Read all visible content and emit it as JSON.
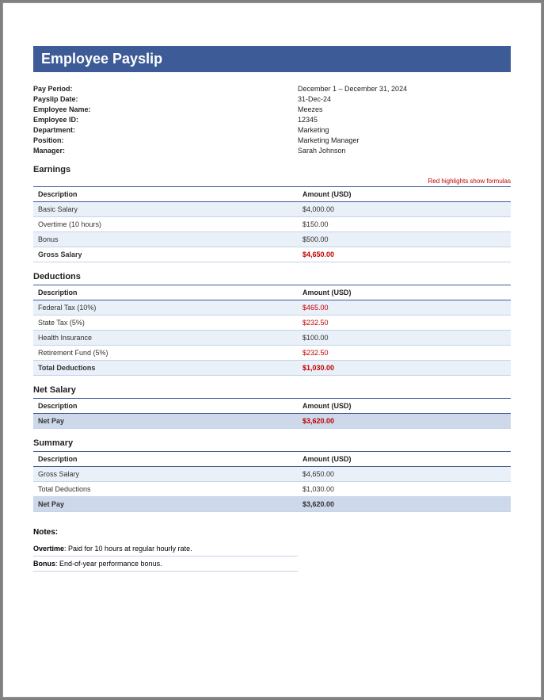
{
  "title": "Employee Payslip",
  "formula_note": "Red highlights show formulas",
  "header": {
    "pay_period": {
      "label": "Pay Period:",
      "value": "December 1 – December 31, 2024"
    },
    "payslip_date": {
      "label": "Payslip Date:",
      "value": "31-Dec-24"
    },
    "employee_name": {
      "label": "Employee Name:",
      "value": "Meezes"
    },
    "employee_id": {
      "label": "Employee ID:",
      "value": "12345"
    },
    "department": {
      "label": "Department:",
      "value": "Marketing"
    },
    "position": {
      "label": "Position:",
      "value": "Marketing Manager"
    },
    "manager": {
      "label": "Manager:",
      "value": "Sarah Johnson"
    }
  },
  "earnings": {
    "heading": "Earnings",
    "col_desc": "Description",
    "col_amount": "Amount (USD)",
    "rows": [
      {
        "desc": "Basic Salary",
        "amount": "$4,000.00"
      },
      {
        "desc": "Overtime (10 hours)",
        "amount": "$150.00"
      },
      {
        "desc": "Bonus",
        "amount": "$500.00"
      }
    ],
    "total": {
      "desc": "Gross Salary",
      "amount": "$4,650.00"
    }
  },
  "deductions": {
    "heading": "Deductions",
    "col_desc": "Description",
    "col_amount": "Amount (USD)",
    "rows": [
      {
        "desc": "Federal Tax (10%)",
        "amount": "$465.00"
      },
      {
        "desc": "State Tax (5%)",
        "amount": "$232.50"
      },
      {
        "desc": "Health Insurance",
        "amount": "$100.00"
      },
      {
        "desc": "Retirement Fund (5%)",
        "amount": "$232.50"
      }
    ],
    "total": {
      "desc": "Total Deductions",
      "amount": "$1,030.00"
    }
  },
  "net_salary": {
    "heading": "Net Salary",
    "col_desc": "Description",
    "col_amount": "Amount (USD)",
    "row": {
      "desc": "Net Pay",
      "amount": "$3,620.00"
    }
  },
  "summary": {
    "heading": "Summary",
    "col_desc": "Description",
    "col_amount": "Amount (USD)",
    "rows": [
      {
        "desc": "Gross Salary",
        "amount": "$4,650.00"
      },
      {
        "desc": "Total Deductions",
        "amount": "$1,030.00"
      }
    ],
    "total": {
      "desc": "Net Pay",
      "amount": "$3,620.00"
    }
  },
  "notes": {
    "heading": "Notes:",
    "items": [
      {
        "label": "Overtime",
        "text": ": Paid for 10 hours at regular hourly rate."
      },
      {
        "label": "Bonus",
        "text": ": End-of-year performance bonus."
      }
    ]
  }
}
